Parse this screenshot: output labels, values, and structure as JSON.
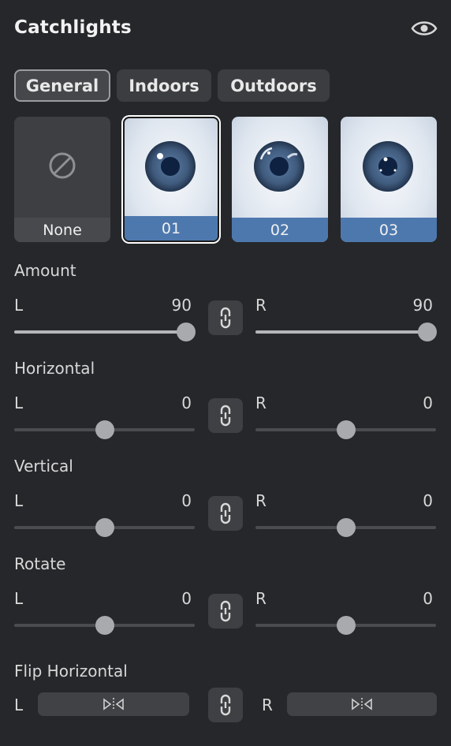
{
  "panel": {
    "title": "Catchlights",
    "visibility_icon": "eye-icon"
  },
  "tabs": [
    {
      "label": "General",
      "active": true
    },
    {
      "label": "Indoors",
      "active": false
    },
    {
      "label": "Outdoors",
      "active": false
    }
  ],
  "presets": [
    {
      "label": "None",
      "icon": "no-catchlight-icon"
    },
    {
      "label": "01",
      "selected": true
    },
    {
      "label": "02"
    },
    {
      "label": "03"
    }
  ],
  "controls": [
    {
      "label": "Amount",
      "left": {
        "label": "L",
        "value": "90"
      },
      "right": {
        "label": "R",
        "value": "90"
      }
    },
    {
      "label": "Horizontal",
      "left": {
        "label": "L",
        "value": "0"
      },
      "right": {
        "label": "R",
        "value": "0"
      }
    },
    {
      "label": "Vertical",
      "left": {
        "label": "L",
        "value": "0"
      },
      "right": {
        "label": "R",
        "value": "0"
      }
    },
    {
      "label": "Rotate",
      "left": {
        "label": "L",
        "value": "0"
      },
      "right": {
        "label": "R",
        "value": "0"
      }
    }
  ],
  "flip": {
    "label": "Flip Horizontal",
    "left_label": "L",
    "right_label": "R",
    "button_icon": "flip-horizontal-icon"
  },
  "link_icon": "link-icon",
  "colors": {
    "background": "#25272a",
    "accent": "#4d78ae"
  }
}
